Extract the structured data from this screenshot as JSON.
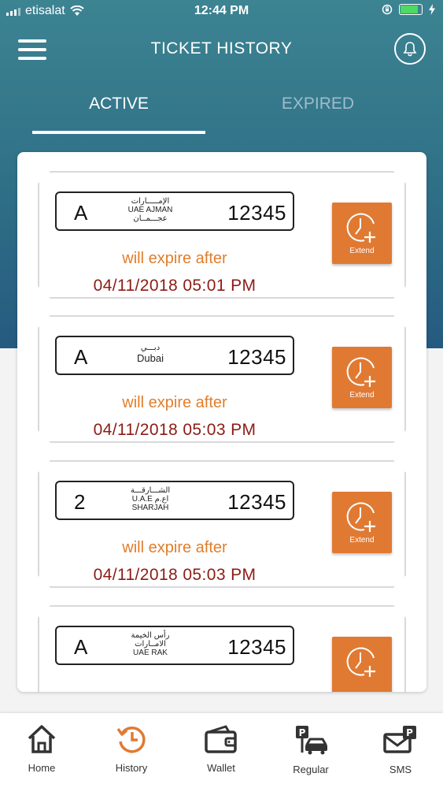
{
  "status_bar": {
    "carrier": "etisalat",
    "time": "12:44 PM"
  },
  "header": {
    "title": "TICKET HISTORY"
  },
  "tabs": [
    {
      "label": "ACTIVE",
      "active": true
    },
    {
      "label": "EXPIRED",
      "active": false
    }
  ],
  "tickets": [
    {
      "plate_code": "A",
      "emirate_lines": [
        "الإمـــــارات",
        "UAE AJMAN",
        "عجـــمــان"
      ],
      "plate_number": "12345",
      "expire_label": "will expire after",
      "expire_datetime": "04/11/2018  05:01 PM",
      "extend_label": "Extend"
    },
    {
      "plate_code": "A",
      "emirate_lines": [
        "دبـــي",
        "Dubai"
      ],
      "plate_number": "12345",
      "expire_label": "will expire after",
      "expire_datetime": "04/11/2018  05:03 PM",
      "extend_label": "Extend"
    },
    {
      "plate_code": "2",
      "emirate_lines": [
        "الشـــارقـــة",
        "U.A.E  اع.م",
        "SHARJAH"
      ],
      "plate_number": "12345",
      "expire_label": "will expire after",
      "expire_datetime": "04/11/2018  05:03 PM",
      "extend_label": "Extend"
    },
    {
      "plate_code": "A",
      "emirate_lines": [
        "رأس الخيمة",
        "الامــارات",
        "UAE  RAK"
      ],
      "plate_number": "12345",
      "expire_label": "",
      "expire_datetime": "",
      "extend_label": ""
    }
  ],
  "bottom_nav": [
    {
      "label": "Home",
      "icon": "home-icon",
      "active": false
    },
    {
      "label": "History",
      "icon": "history-icon",
      "active": true
    },
    {
      "label": "Wallet",
      "icon": "wallet-icon",
      "active": false
    },
    {
      "label": "Regular",
      "icon": "regular-parking-icon",
      "active": false
    },
    {
      "label": "SMS",
      "icon": "sms-parking-icon",
      "active": false
    }
  ],
  "colors": {
    "header_gradient_top": "#3c8492",
    "header_gradient_bottom": "#255a80",
    "accent_orange": "#e07a33",
    "expire_label": "#e07e2c",
    "expire_date": "#8b1c14"
  }
}
